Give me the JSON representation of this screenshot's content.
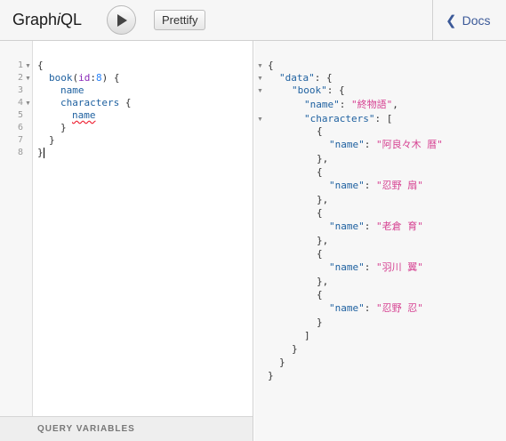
{
  "app": {
    "logo_prefix": "Graph",
    "logo_i": "i",
    "logo_suffix": "QL"
  },
  "toolbar": {
    "run_icon": "play-icon",
    "prettify_label": "Prettify",
    "docs_label": "Docs",
    "docs_icon": "chevron-left-icon"
  },
  "query_editor": {
    "line_numbers": [
      "1",
      "2",
      "3",
      "4",
      "5",
      "6",
      "7",
      "8"
    ],
    "lines": {
      "l1": "{",
      "l2_field": "book",
      "l2_arg": "id",
      "l2_val": "8",
      "l3": "name",
      "l4": "characters",
      "l5": "name",
      "l6": "}",
      "l7": "}",
      "l8": "}"
    }
  },
  "query_variables": {
    "label": "QUERY VARIABLES"
  },
  "result": {
    "data_key": "\"data\"",
    "book_key": "\"book\"",
    "name_key": "\"name\"",
    "book_name": "\"終物語\"",
    "characters_key": "\"characters\"",
    "characters": [
      "\"阿良々木 暦\"",
      "\"忍野 扇\"",
      "\"老倉 育\"",
      "\"羽川 翼\"",
      "\"忍野 忍\""
    ]
  }
}
